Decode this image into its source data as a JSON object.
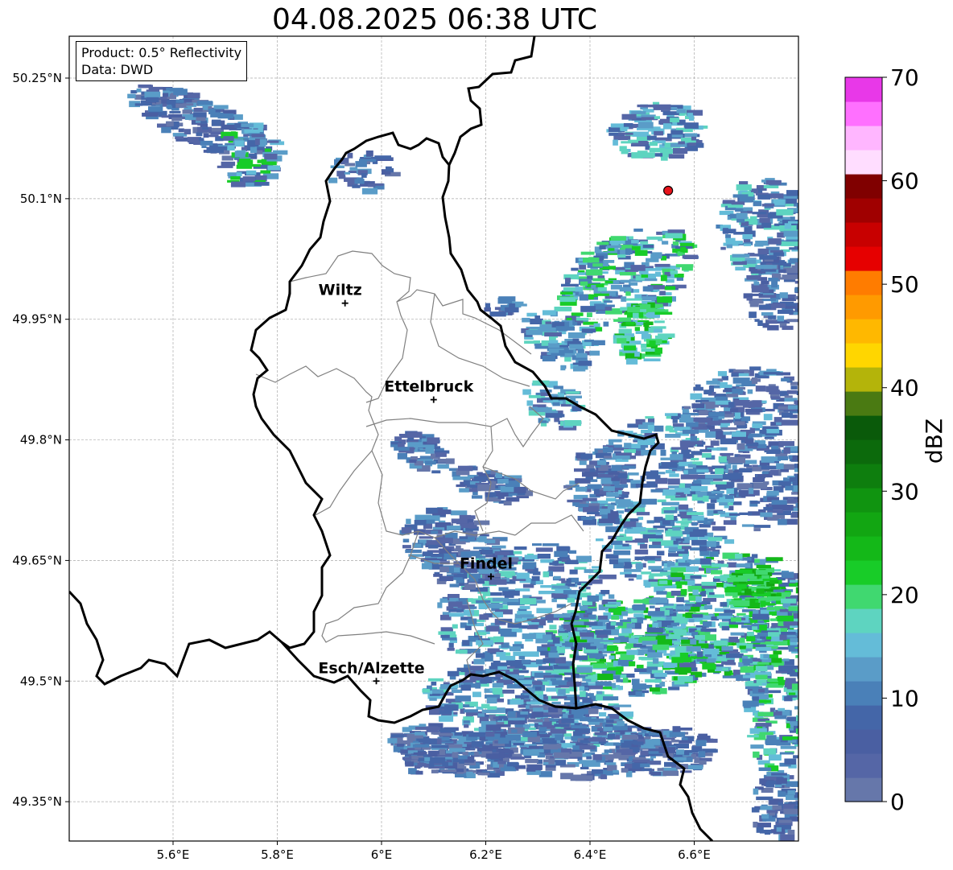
{
  "title": "04.08.2025 06:38 UTC",
  "info": {
    "product": "Product: 0.5° Reflectivity",
    "source": "Data: DWD"
  },
  "axes": {
    "lat_ticks": [
      {
        "value": 50.25,
        "label": "50.25°N"
      },
      {
        "value": 50.1,
        "label": "50.1°N"
      },
      {
        "value": 49.95,
        "label": "49.95°N"
      },
      {
        "value": 49.8,
        "label": "49.8°N"
      },
      {
        "value": 49.65,
        "label": "49.65°N"
      },
      {
        "value": 49.5,
        "label": "49.5°N"
      },
      {
        "value": 49.35,
        "label": "49.35°N"
      }
    ],
    "lon_ticks": [
      {
        "value": 5.6,
        "label": "5.6°E"
      },
      {
        "value": 5.8,
        "label": "5.8°E"
      },
      {
        "value": 6.0,
        "label": "6°E"
      },
      {
        "value": 6.2,
        "label": "6.2°E"
      },
      {
        "value": 6.4,
        "label": "6.4°E"
      },
      {
        "value": 6.6,
        "label": "6.6°E"
      }
    ],
    "lon_range": [
      5.4,
      6.8
    ],
    "lat_range": [
      49.3,
      50.3
    ],
    "grid": true
  },
  "cities": [
    {
      "name": "Wiltz",
      "lon": 5.93,
      "lat": 49.97
    },
    {
      "name": "Ettelbruck",
      "lon": 6.1,
      "lat": 49.85
    },
    {
      "name": "Findel",
      "lon": 6.21,
      "lat": 49.63
    },
    {
      "name": "Esch/Alzette",
      "lon": 5.99,
      "lat": 49.5
    }
  ],
  "radar_site": {
    "lon": 6.55,
    "lat": 50.11,
    "color": "#e8141c"
  },
  "colorbar": {
    "label": "dBZ",
    "ticks": [
      {
        "value": 0,
        "label": "0"
      },
      {
        "value": 10,
        "label": "10"
      },
      {
        "value": 20,
        "label": "20"
      },
      {
        "value": 30,
        "label": "30"
      },
      {
        "value": 40,
        "label": "40"
      },
      {
        "value": 50,
        "label": "50"
      },
      {
        "value": 60,
        "label": "60"
      },
      {
        "value": 70,
        "label": "70"
      }
    ],
    "colors": [
      "#6677aa",
      "#5566a6",
      "#4a5fa2",
      "#4466a8",
      "#4a80b8",
      "#5a9cc8",
      "#64bcd8",
      "#5ed4c0",
      "#40d870",
      "#18cc28",
      "#14b818",
      "#12a612",
      "#109410",
      "#0e7e0e",
      "#0c6a0c",
      "#0a5a0a",
      "#4a7a12",
      "#b4b40a",
      "#ffd600",
      "#ffb800",
      "#ff9a00",
      "#ff7c00",
      "#e60000",
      "#c80000",
      "#a00000",
      "#800000",
      "#ffddff",
      "#ffb6ff",
      "#ff70ff",
      "#e838e8"
    ],
    "range": [
      0,
      70
    ]
  },
  "chart_data": {
    "type": "heatmap",
    "title": "04.08.2025 06:38 UTC",
    "colorbar_label": "dBZ",
    "value_range": [
      0,
      70
    ],
    "x_range": [
      5.4,
      6.8
    ],
    "y_range": [
      49.3,
      50.3
    ],
    "echo_areas": [
      {
        "lon": 5.7,
        "lat": 50.2,
        "max_dbz": 22
      },
      {
        "lon": 6.5,
        "lat": 50.02,
        "max_dbz": 26
      },
      {
        "lon": 6.8,
        "lat": 49.61,
        "max_dbz": 24
      },
      {
        "lon": 6.5,
        "lat": 49.55,
        "max_dbz": 25
      },
      {
        "lon": 6.3,
        "lat": 49.45,
        "max_dbz": 18
      }
    ]
  }
}
